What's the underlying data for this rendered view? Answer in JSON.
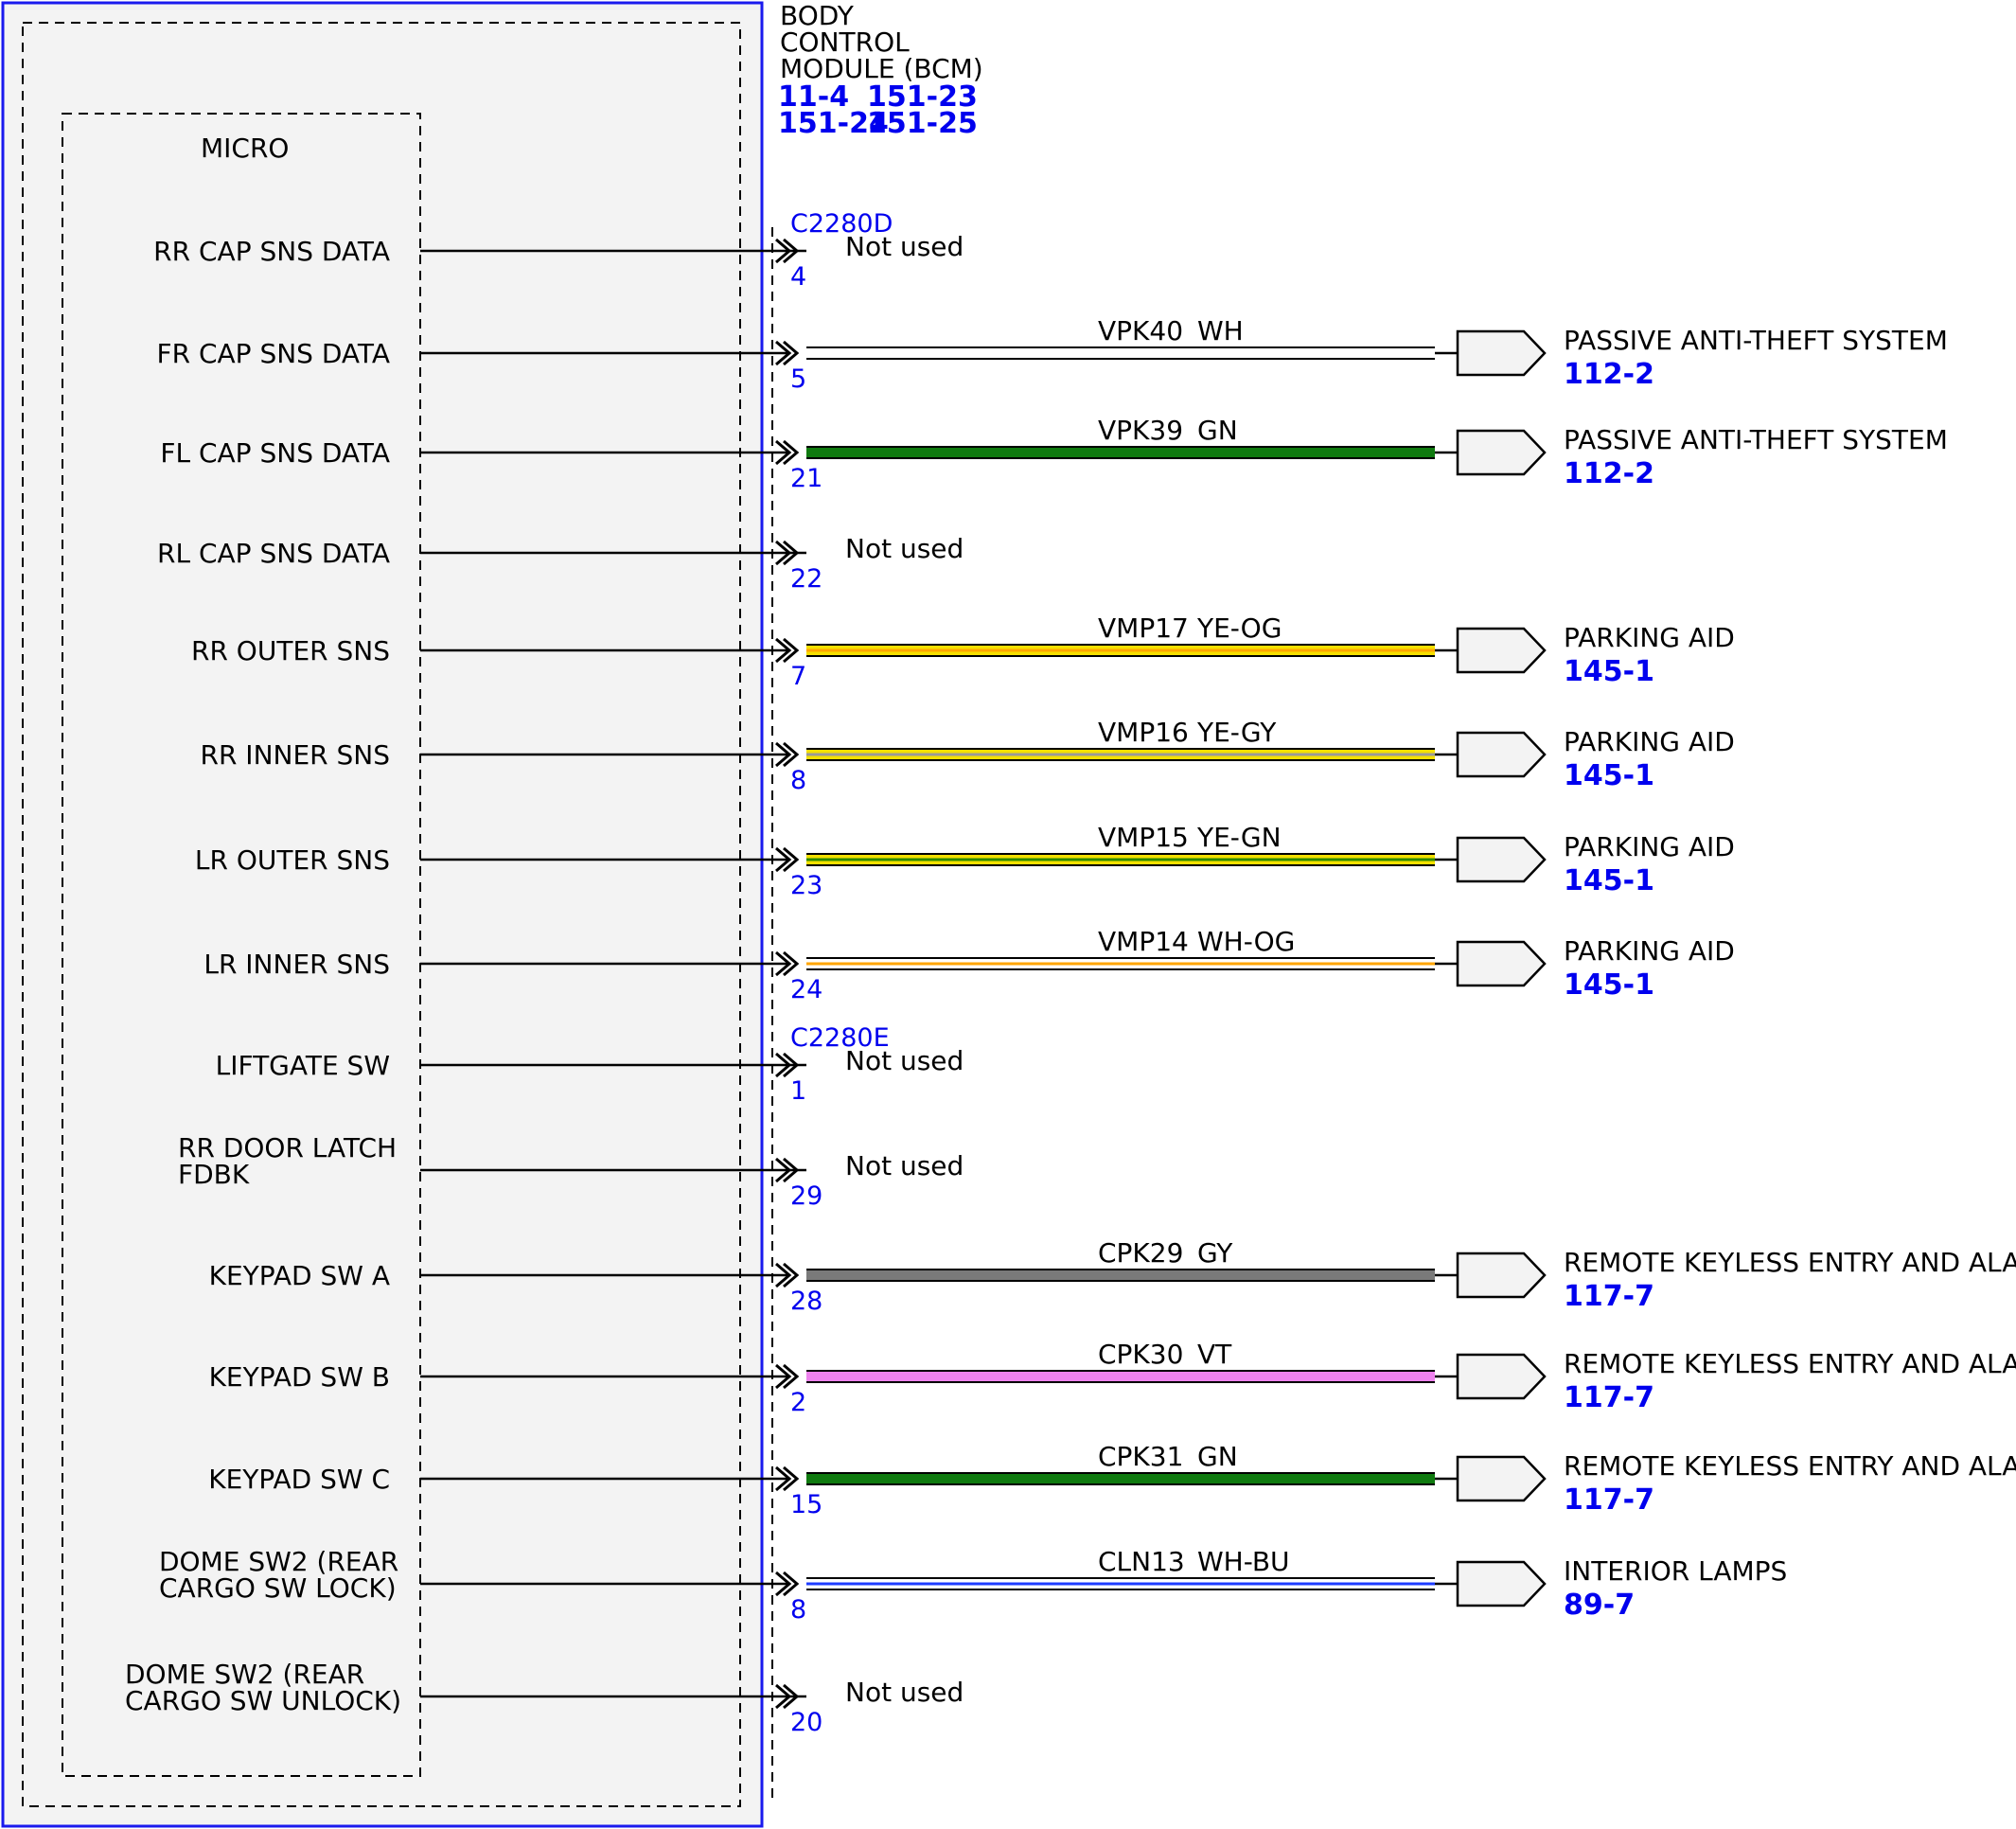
{
  "module": {
    "title_lines": [
      "BODY",
      "CONTROL",
      "MODULE (BCM)"
    ],
    "refs": [
      "11-4",
      "151-23",
      "151-24",
      "151-25"
    ],
    "micro_label": "MICRO"
  },
  "connectors": [
    {
      "name": "C2280D"
    },
    {
      "name": "C2280E"
    }
  ],
  "circuits": [
    {
      "signal": [
        "RR CAP SNS DATA"
      ],
      "pin": "4",
      "used": false,
      "not_used_text": "Not used",
      "connector_above": "C2280D"
    },
    {
      "signal": [
        "FR CAP SNS DATA"
      ],
      "pin": "5",
      "used": true,
      "circuit": "VPK40",
      "color_code": "WH",
      "colors": [
        "#ffffff"
      ],
      "dest": "PASSIVE ANTI-THEFT SYSTEM",
      "dest_ref": "112-2"
    },
    {
      "signal": [
        "FL CAP SNS DATA"
      ],
      "pin": "21",
      "used": true,
      "circuit": "VPK39",
      "color_code": "GN",
      "colors": [
        "#0f7a0f"
      ],
      "dest": "PASSIVE ANTI-THEFT SYSTEM",
      "dest_ref": "112-2"
    },
    {
      "signal": [
        "RL CAP SNS DATA"
      ],
      "pin": "22",
      "used": false,
      "not_used_text": "Not used"
    },
    {
      "signal": [
        "RR OUTER SNS"
      ],
      "pin": "7",
      "used": true,
      "circuit": "VMP17",
      "color_code": "YE-OG",
      "colors": [
        "#f5e000",
        "#ffa500"
      ],
      "dest": "PARKING AID",
      "dest_ref": "145-1"
    },
    {
      "signal": [
        "RR INNER SNS"
      ],
      "pin": "8",
      "used": true,
      "circuit": "VMP16",
      "color_code": "YE-GY",
      "colors": [
        "#f5e000",
        "#9a9a9a"
      ],
      "dest": "PARKING AID",
      "dest_ref": "145-1"
    },
    {
      "signal": [
        "LR OUTER SNS"
      ],
      "pin": "23",
      "used": true,
      "circuit": "VMP15",
      "color_code": "YE-GN",
      "colors": [
        "#f5e000",
        "#2e8b00"
      ],
      "dest": "PARKING AID",
      "dest_ref": "145-1"
    },
    {
      "signal": [
        "LR INNER SNS"
      ],
      "pin": "24",
      "used": true,
      "circuit": "VMP14",
      "color_code": "WH-OG",
      "colors": [
        "#ffffff",
        "#ffa500"
      ],
      "dest": "PARKING AID",
      "dest_ref": "145-1"
    },
    {
      "signal": [
        "LIFTGATE SW"
      ],
      "pin": "1",
      "used": false,
      "not_used_text": "Not used",
      "connector_above": "C2280E"
    },
    {
      "signal": [
        "RR DOOR LATCH",
        "FDBK"
      ],
      "pin": "29",
      "used": false,
      "not_used_text": "Not used"
    },
    {
      "signal": [
        "KEYPAD SW A"
      ],
      "pin": "28",
      "used": true,
      "circuit": "CPK29",
      "color_code": "GY",
      "colors": [
        "#7a7a7a"
      ],
      "dest": "REMOTE KEYLESS ENTRY AND ALARM",
      "dest_ref": "117-7"
    },
    {
      "signal": [
        "KEYPAD SW B"
      ],
      "pin": "2",
      "used": true,
      "circuit": "CPK30",
      "color_code": "VT",
      "colors": [
        "#ee82ee"
      ],
      "dest": "REMOTE KEYLESS ENTRY AND ALARM",
      "dest_ref": "117-7"
    },
    {
      "signal": [
        "KEYPAD SW C"
      ],
      "pin": "15",
      "used": true,
      "circuit": "CPK31",
      "color_code": "GN",
      "colors": [
        "#0f7a0f"
      ],
      "dest": "REMOTE KEYLESS ENTRY AND ALARM",
      "dest_ref": "117-7"
    },
    {
      "signal": [
        "DOME SW2 (REAR",
        "CARGO SW LOCK)"
      ],
      "pin": "8",
      "used": true,
      "circuit": "CLN13",
      "color_code": "WH-BU",
      "colors": [
        "#ffffff",
        "#1e3cff"
      ],
      "dest": "INTERIOR LAMPS",
      "dest_ref": "89-7"
    },
    {
      "signal": [
        "DOME SW2 (REAR",
        "CARGO SW UNLOCK)"
      ],
      "pin": "20",
      "used": false,
      "not_used_text": "Not used"
    }
  ]
}
